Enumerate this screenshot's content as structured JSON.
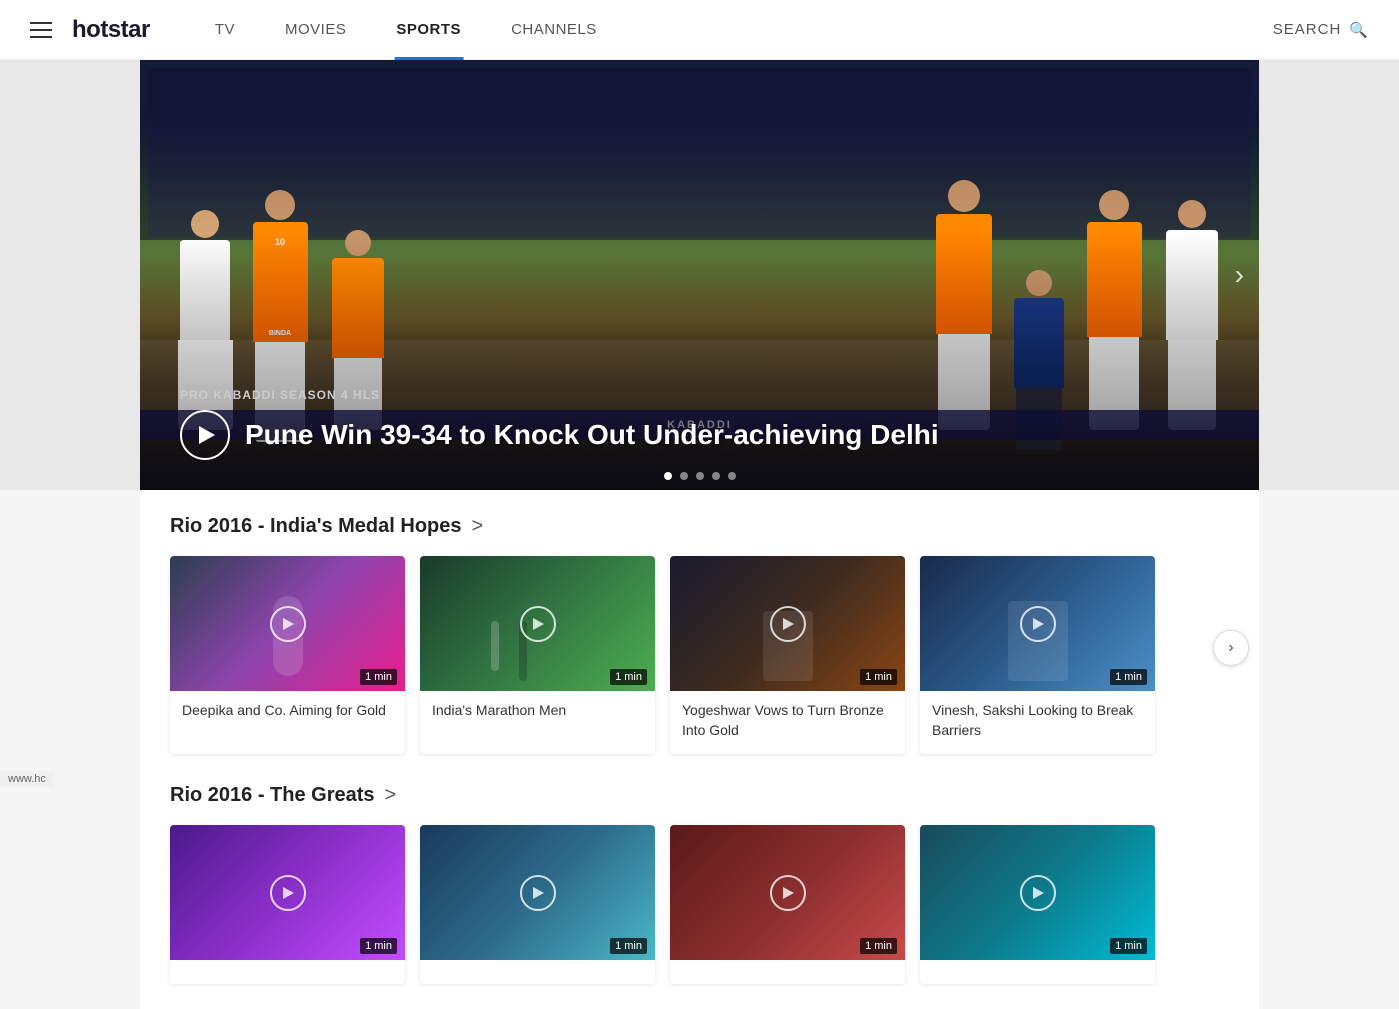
{
  "header": {
    "logo": "hotstar",
    "hamburger_label": "menu",
    "nav": [
      {
        "id": "tv",
        "label": "TV",
        "active": false
      },
      {
        "id": "movies",
        "label": "MOVIES",
        "active": false
      },
      {
        "id": "sports",
        "label": "SPORTS",
        "active": true
      },
      {
        "id": "channels",
        "label": "CHANNELS",
        "active": false
      }
    ],
    "search_label": "SEARCH",
    "search_icon": "🔍"
  },
  "hero": {
    "category": "PRO KABADDI SEASON 4 HLS",
    "title": "Pune Win 39-34 to Knock Out Under-achieving Delhi",
    "dots": [
      true,
      false,
      false,
      false,
      false
    ],
    "play_button": "play"
  },
  "section1": {
    "title": "Rio 2016 - India's Medal Hopes",
    "arrow": ">",
    "cards": [
      {
        "id": "card-1",
        "title": "Deepika and Co. Aiming for Gold",
        "duration": "1 min",
        "color_class": "card-1"
      },
      {
        "id": "card-2",
        "title": "India's Marathon Men",
        "duration": "1 min",
        "color_class": "card-2"
      },
      {
        "id": "card-3",
        "title": "Yogeshwar Vows to Turn Bronze Into Gold",
        "duration": "1 min",
        "color_class": "card-3"
      },
      {
        "id": "card-4",
        "title": "Vinesh, Sakshi Looking to Break Barriers",
        "duration": "1 min",
        "color_class": "card-4"
      }
    ]
  },
  "section2": {
    "title": "Rio 2016 - The Greats",
    "arrow": ">",
    "cards": [
      {
        "id": "card-5",
        "title": "",
        "duration": "1 min",
        "color_class": "card-5"
      },
      {
        "id": "card-6",
        "title": "",
        "duration": "1 min",
        "color_class": "card-6"
      },
      {
        "id": "card-7",
        "title": "",
        "duration": "1 min",
        "color_class": "card-7"
      },
      {
        "id": "card-8",
        "title": "",
        "duration": "1 min",
        "color_class": "card-8"
      }
    ]
  },
  "site_url": "www.hc"
}
